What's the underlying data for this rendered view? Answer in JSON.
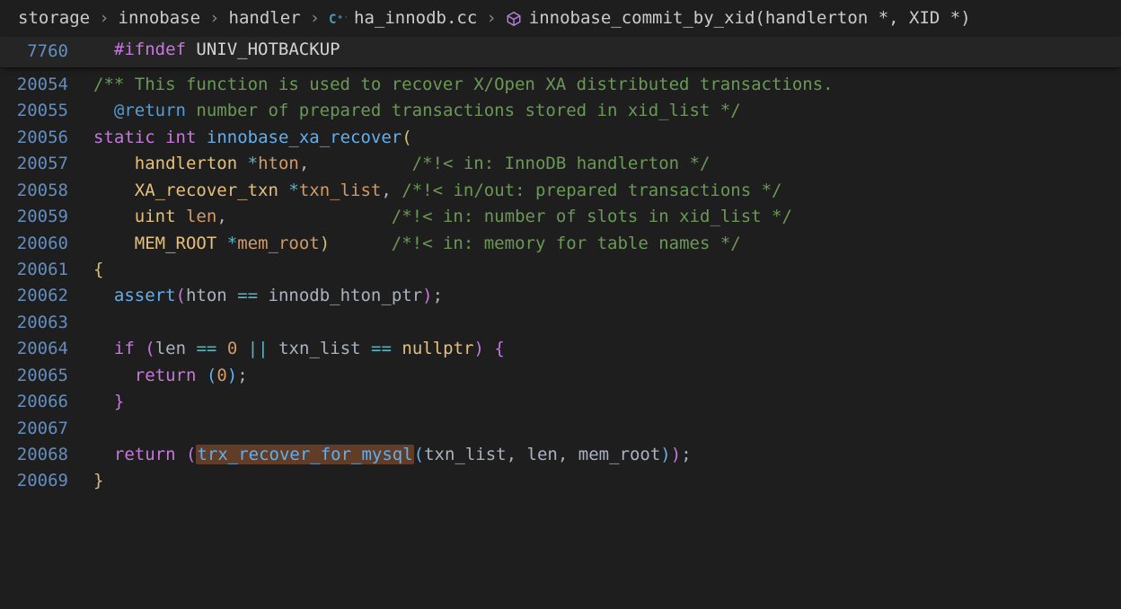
{
  "breadcrumbs": {
    "seg0": "storage",
    "seg1": "innobase",
    "seg2": "handler",
    "seg3": "ha_innodb.cc",
    "seg4": "innobase_commit_by_xid(handlerton *, XID *)",
    "sep": "›"
  },
  "sticky": {
    "lineno": "7760",
    "directive": "#ifndef",
    "macro": "UNIV_HOTBACKUP"
  },
  "lines": {
    "l0": {
      "n": "20054",
      "c0": "/** This function is used to recover X/Open XA distributed transactions."
    },
    "l1": {
      "n": "20055",
      "at": " @return",
      "rest": " number of prepared transactions stored in xid_list */"
    },
    "l2": {
      "n": "20056",
      "kw_static": "static",
      "kw_int": "int",
      "fn": "innobase_xa_recover",
      "paren": "("
    },
    "l3": {
      "n": "20057",
      "ty": "handlerton",
      "star": "*",
      "id": "hton",
      "comma": ",",
      "pad": "          ",
      "cm": "/*!< in: InnoDB handlerton */"
    },
    "l4": {
      "n": "20058",
      "ty": "XA_recover_txn",
      "star": "*",
      "id": "txn_list",
      "comma": ",",
      "pad": " ",
      "cm": "/*!< in/out: prepared transactions */"
    },
    "l5": {
      "n": "20059",
      "ty": "uint",
      "id": "len",
      "comma": ",",
      "pad": "                ",
      "cm": "/*!< in: number of slots in xid_list */"
    },
    "l6": {
      "n": "20060",
      "ty": "MEM_ROOT",
      "star": "*",
      "id": "mem_root",
      "paren": ")",
      "pad": "      ",
      "cm": "/*!< in: memory for table names */"
    },
    "l7": {
      "n": "20061",
      "brace": "{"
    },
    "l8": {
      "n": "20062",
      "fn": "assert",
      "lp": "(",
      "id0": "hton",
      "op": "==",
      "id1": "innodb_hton_ptr",
      "rp": ")",
      "semi": ";"
    },
    "l9": {
      "n": "20063"
    },
    "l10": {
      "n": "20064",
      "kw": "if",
      "lp": "(",
      "id0": "len",
      "op0": "==",
      "num": "0",
      "op1": "||",
      "id1": "txn_list",
      "op2": "==",
      "nl": "nullptr",
      "rp": ")",
      "lb": "{"
    },
    "l11": {
      "n": "20065",
      "kw": "return",
      "lp": "(",
      "num": "0",
      "rp": ")",
      "semi": ";"
    },
    "l12": {
      "n": "20066",
      "rb": "}"
    },
    "l13": {
      "n": "20067"
    },
    "l14": {
      "n": "20068",
      "kw": "return",
      "lp": "(",
      "fn": "trx_recover_for_mysql",
      "lp2": "(",
      "a0": "txn_list",
      "c": ",",
      "a1": "len",
      "a2": "mem_root",
      "rp2": ")",
      "rp": ")",
      "semi": ";"
    },
    "l15": {
      "n": "20069",
      "rb": "}"
    }
  }
}
